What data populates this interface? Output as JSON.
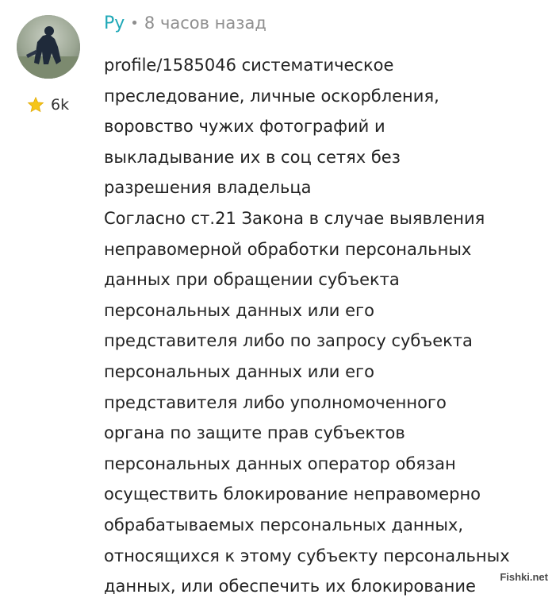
{
  "comment": {
    "author": "Ру",
    "separator": "•",
    "time": "8 часов назад",
    "rating": "6k",
    "lines": [
      "profile/1585046 систематическое",
      "преследование, личные оскорбления,",
      "воровство чужих фотографий и",
      "выкладывание их в соц сетях без",
      "разрешения владельца",
      "Согласно ст.21 Закона в случае выявления",
      "неправомерной обработки персональных",
      "данных при обращении субъекта",
      "персональных данных или его",
      "представителя либо по запросу субъекта",
      "персональных данных или его",
      "представителя либо уполномоченного",
      "органа по защите прав субъектов",
      "персональных данных оператор обязан",
      "осуществить блокирование неправомерно",
      "обрабатываемых персональных данных,",
      "относящихся к этому субъекту персональных",
      "данных, или обеспечить их блокирование"
    ]
  },
  "watermark": "Fishki.net",
  "colors": {
    "author": "#1fa8b7",
    "meta": "#8e8e8e",
    "text": "#232323",
    "star": "#f5c518"
  },
  "icons": {
    "avatar": "avatar-photo",
    "rating": "star-icon"
  }
}
